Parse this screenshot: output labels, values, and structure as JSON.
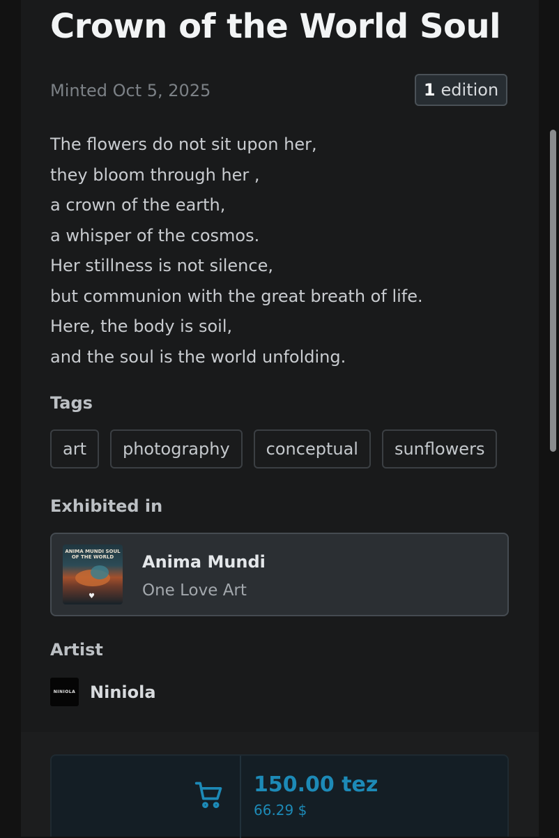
{
  "title": "Crown of the World Soul",
  "minted": "Minted Oct 5, 2025",
  "edition": {
    "count": "1",
    "label": "edition"
  },
  "description_lines": [
    "The flowers do not sit upon her,",
    "they bloom through her ,",
    "a crown of the earth,",
    "a whisper of the cosmos.",
    "Her stillness is not silence,",
    "but communion with the great breath of life.",
    "Here, the body is soil,",
    "and the soul is the world unfolding."
  ],
  "tags_heading": "Tags",
  "tags": [
    "art",
    "photography",
    "conceptual",
    "sunflowers"
  ],
  "exhibited_heading": "Exhibited in",
  "exhibition": {
    "name": "Anima Mundi",
    "curator": "One Love Art",
    "thumbnail_text": "ANIMA MUNDI SOUL OF THE WORLD"
  },
  "artist_heading": "Artist",
  "artist": {
    "name": "Niniola",
    "avatar_text": "NINIOLA"
  },
  "purchase": {
    "price_tez": "150.00 tez",
    "price_usd": "66.29 $",
    "icon": "cart-icon"
  },
  "colors": {
    "background": "#121212",
    "panel": "#191a1b",
    "accent": "#1d8ab7",
    "card": "#2b2f33"
  }
}
